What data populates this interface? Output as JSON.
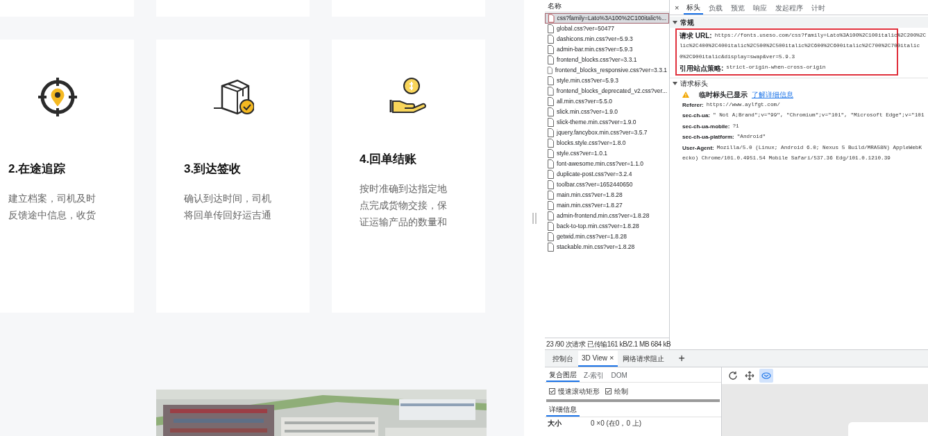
{
  "steps": [
    {
      "title": "2.在途追踪",
      "text": "建立档案，司机及时反馈途中信息，收货"
    },
    {
      "title": "3.到达签收",
      "text": "确认到达时间，司机将回单传回好运吉通"
    },
    {
      "title": "4.回单结账",
      "text": "按时准确到达指定地点完成货物交接，保证运输产品的数量和"
    }
  ],
  "devtools": {
    "name_column": {
      "header": "名称"
    },
    "requests": [
      {
        "name": "css?family=Lato%3A100%2C100italic%...",
        "selected": true
      },
      {
        "name": "global.css?ver=50477",
        "selected": false
      },
      {
        "name": "dashicons.min.css?ver=5.9.3",
        "selected": false
      },
      {
        "name": "admin-bar.min.css?ver=5.9.3",
        "selected": false
      },
      {
        "name": "frontend_blocks.css?ver=3.3.1",
        "selected": false
      },
      {
        "name": "frontend_blocks_responsive.css?ver=3.3.1",
        "selected": false
      },
      {
        "name": "style.min.css?ver=5.9.3",
        "selected": false
      },
      {
        "name": "frontend_blocks_deprecated_v2.css?ver...",
        "selected": false
      },
      {
        "name": "all.min.css?ver=5.5.0",
        "selected": false
      },
      {
        "name": "slick.min.css?ver=1.9.0",
        "selected": false
      },
      {
        "name": "slick-theme.min.css?ver=1.9.0",
        "selected": false
      },
      {
        "name": "jquery.fancybox.min.css?ver=3.5.7",
        "selected": false
      },
      {
        "name": "blocks.style.css?ver=1.8.0",
        "selected": false
      },
      {
        "name": "style.css?ver=1.0.1",
        "selected": false
      },
      {
        "name": "font-awesome.min.css?ver=1.1.0",
        "selected": false
      },
      {
        "name": "duplicate-post.css?ver=3.2.4",
        "selected": false
      },
      {
        "name": "toolbar.css?ver=1652440650",
        "selected": false
      },
      {
        "name": "main.min.css?ver=1.8.28",
        "selected": false
      },
      {
        "name": "main.min.css?ver=1.8.27",
        "selected": false
      },
      {
        "name": "admin-frontend.min.css?ver=1.8.28",
        "selected": false
      },
      {
        "name": "back-to-top.min.css?ver=1.8.28",
        "selected": false
      },
      {
        "name": "getwid.min.css?ver=1.8.28",
        "selected": false
      },
      {
        "name": "stackable.min.css?ver=1.8.28",
        "selected": false
      }
    ],
    "summary": "23 /90 次请求  已传输161 kB/2.1 MB  684 kB",
    "close_label": "×",
    "detail_tabs": [
      {
        "label": "标头",
        "selected": true
      },
      {
        "label": "负载",
        "selected": false
      },
      {
        "label": "预览",
        "selected": false
      },
      {
        "label": "响应",
        "selected": false
      },
      {
        "label": "发起程序",
        "selected": false
      },
      {
        "label": "计时",
        "selected": false
      }
    ],
    "general": {
      "title": "常规",
      "expanded": true,
      "highlighted": true,
      "rows": [
        {
          "key": "请求 URL:",
          "lines": [
            "https://fonts.useso.com/css?family=Lato%3A100%2C100italic%2C200%2C",
            "lic%2C400%2C400italic%2C500%2C500italic%2C600%2C600italic%2C700%2C700italic",
            "0%2C900italic&display=swap&ver=5.9.3"
          ]
        },
        {
          "key": "引用站点策略:",
          "lines": [
            "strict-origin-when-cross-origin"
          ]
        }
      ]
    },
    "request_headers": {
      "title": "请求标头",
      "expanded": true,
      "warning": "临时标头已显示",
      "link": "了解详细信息",
      "rows": [
        {
          "key": "Referer:",
          "lines": [
            "https://www.aylfgt.com/"
          ]
        },
        {
          "key": "sec-ch-ua:",
          "lines": [
            "\" Not A;Brand\";v=\"99\", \"Chromium\";v=\"101\", \"Microsoft Edge\";v=\"101"
          ]
        },
        {
          "key": "sec-ch-ua-mobile:",
          "lines": [
            "?1"
          ]
        },
        {
          "key": "sec-ch-ua-platform:",
          "lines": [
            "\"Android\""
          ]
        },
        {
          "key": "User-Agent:",
          "lines": [
            "Mozilla/5.0 (Linux; Android 6.0; Nexus 5 Build/MRA58N) AppleWebK",
            "ecko) Chrome/101.0.4951.54 Mobile Safari/537.36 Edg/101.0.1210.39"
          ]
        }
      ]
    },
    "drawer_tabs": [
      {
        "label": "控制台",
        "selected": false,
        "closable": false
      },
      {
        "label": "3D View",
        "selected": true,
        "closable": true
      },
      {
        "label": "网络请求阻止",
        "selected": false,
        "closable": false
      }
    ],
    "drawer_add": "+",
    "close_tab_label": "×",
    "layer_tabs": [
      {
        "label": "复合图层",
        "selected": true
      },
      {
        "label": "Z-索引",
        "selected": false
      },
      {
        "label": "DOM",
        "selected": false
      }
    ],
    "checkboxes": [
      {
        "label": "慢速滚动矩形",
        "checked": true
      },
      {
        "label": "绘制",
        "checked": true
      }
    ],
    "details_tab": {
      "label": "详细信息",
      "selected": true
    },
    "details": [
      {
        "key": "大小",
        "value": "0 ×0 (在0，0 上)"
      }
    ],
    "toolbar": [
      {
        "active": false
      },
      {
        "active": false
      },
      {
        "active": true
      }
    ]
  }
}
